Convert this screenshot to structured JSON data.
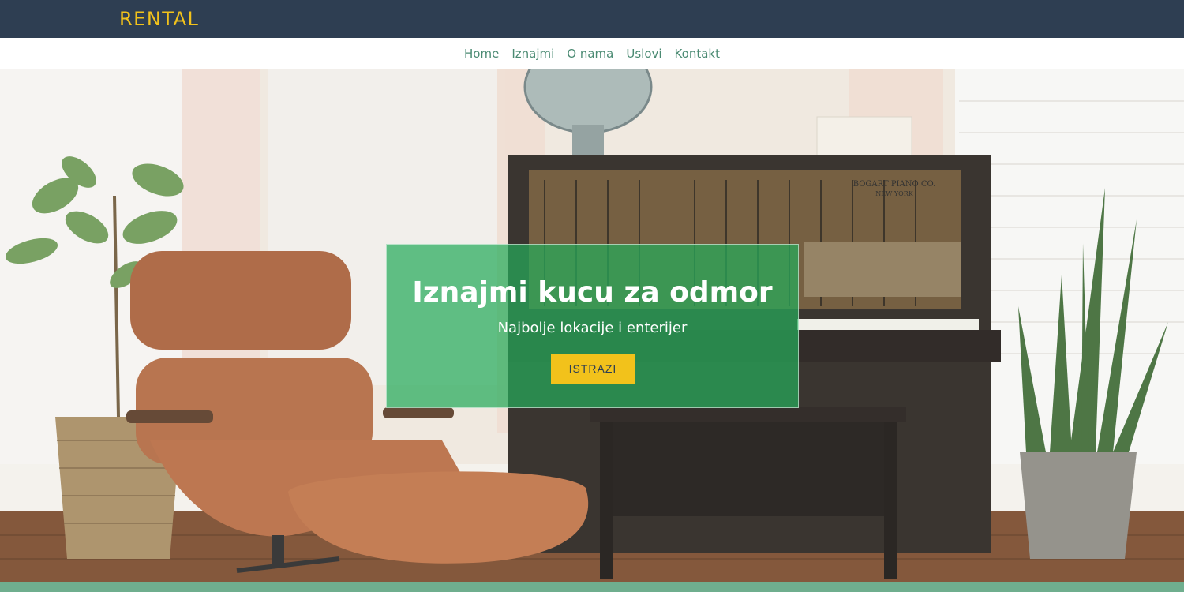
{
  "brand": {
    "logo": "RENTAL"
  },
  "nav": {
    "items": [
      {
        "label": "Home"
      },
      {
        "label": "Iznajmi"
      },
      {
        "label": "O nama"
      },
      {
        "label": "Uslovi"
      },
      {
        "label": "Kontakt"
      }
    ]
  },
  "hero": {
    "title": "Iznajmi kucu za odmor",
    "subtitle": "Najbolje lokacije i enterijer",
    "cta_label": "ISTRAZI",
    "piano_plate": "BOGART PIANO CO.",
    "piano_city": "NEW YORK"
  },
  "colors": {
    "topbar": "#2e3e52",
    "logo": "#f2c21b",
    "nav_link": "#4a8a72",
    "card": "rgba(38,170,90,0.72)",
    "cta": "#f2c21b",
    "strip": "#6fae8e"
  }
}
